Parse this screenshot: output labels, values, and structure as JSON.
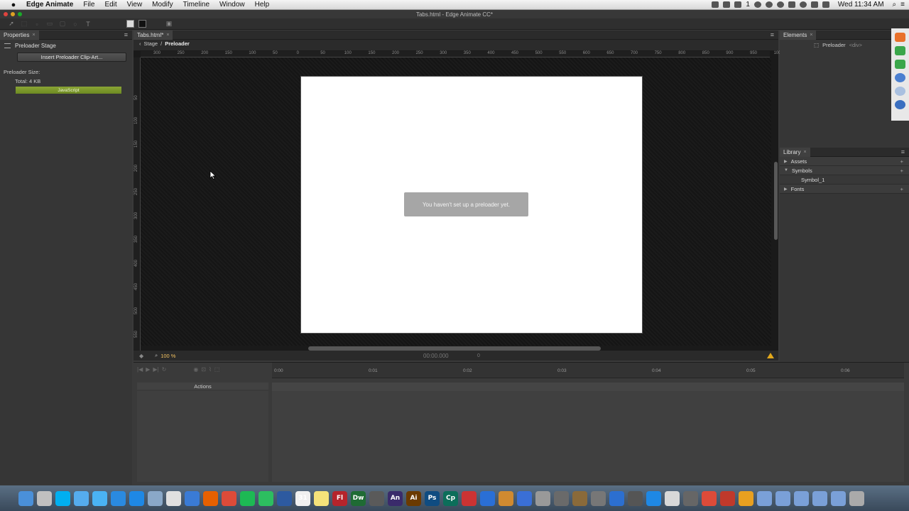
{
  "menubar": {
    "items": [
      "Edge Animate",
      "File",
      "Edit",
      "View",
      "Modify",
      "Timeline",
      "Window",
      "Help"
    ],
    "status": {
      "badge": "1",
      "clock": "Wed 11:34 AM"
    }
  },
  "window": {
    "title": "Tabs.html - Edge Animate CC*"
  },
  "properties": {
    "tab": "Properties",
    "header": "Preloader Stage",
    "insert_button": "Insert Preloader Clip-Art...",
    "size_label": "Preloader Size:",
    "total": "Total: 4 KB",
    "bar_label": "JavaScript"
  },
  "stage": {
    "tab": "Tabs.html*",
    "breadcrumb": {
      "root": "Stage",
      "separator": "/",
      "current": "Preloader"
    },
    "h_ticks": [
      "300",
      "250",
      "200",
      "150",
      "100",
      "50",
      "0",
      "50",
      "100",
      "150",
      "200",
      "250",
      "300",
      "350",
      "400",
      "450",
      "500",
      "550",
      "600",
      "650",
      "700",
      "750",
      "800",
      "850",
      "900",
      "950",
      "1000"
    ],
    "v_ticks": [
      "50",
      "100",
      "150",
      "200",
      "250",
      "300",
      "350",
      "400",
      "450",
      "500",
      "550"
    ],
    "message": "You haven't set up a preloader yet.",
    "zoom": "100 %",
    "timecode": "00:00.000",
    "frame": "0"
  },
  "elements": {
    "tab": "Elements",
    "item": "Preloader",
    "item_tag": "<div>"
  },
  "library": {
    "tab": "Library",
    "assets": "Assets",
    "symbols": "Symbols",
    "symbol_item": "Symbol_1",
    "fonts": "Fonts"
  },
  "timeline": {
    "actions": "Actions",
    "ticks": [
      "0:00",
      "0:01",
      "0:02",
      "0:03",
      "0:04",
      "0:05",
      "0:06"
    ]
  },
  "dock": [
    "Finder",
    "Launchpad",
    "Skype",
    "Twitter",
    "Messages",
    "App Store",
    "Safari",
    "Preview",
    "Clock",
    "Sync",
    "Firefox",
    "Chrome",
    "Spotify",
    "Evernote",
    "Things",
    "Calendar",
    "Notes",
    "Fl",
    "Dw",
    "Sublime",
    "An",
    "Ai",
    "Ps",
    "Cp",
    "Tool",
    "Xcode",
    "Pages",
    "Finder2",
    "Utility",
    "Games",
    "Contacts",
    "System",
    "Keynote",
    "Tool2",
    "Safari2",
    "Photos",
    "Settings",
    "Chrome2",
    "Dash",
    "Tool3",
    "Folder",
    "Folder2",
    "Folder3",
    "Folder4",
    "Folder5",
    "Trash"
  ],
  "dock_labels": {
    "fl": "Fl",
    "dw": "Dw",
    "an": "An",
    "ai": "Ai",
    "ps": "Ps",
    "cp": "Cp",
    "cal": "31"
  },
  "colors": {
    "accent": "#8aa535",
    "warning": "#e2a81b",
    "zoom": "#f0c060"
  }
}
